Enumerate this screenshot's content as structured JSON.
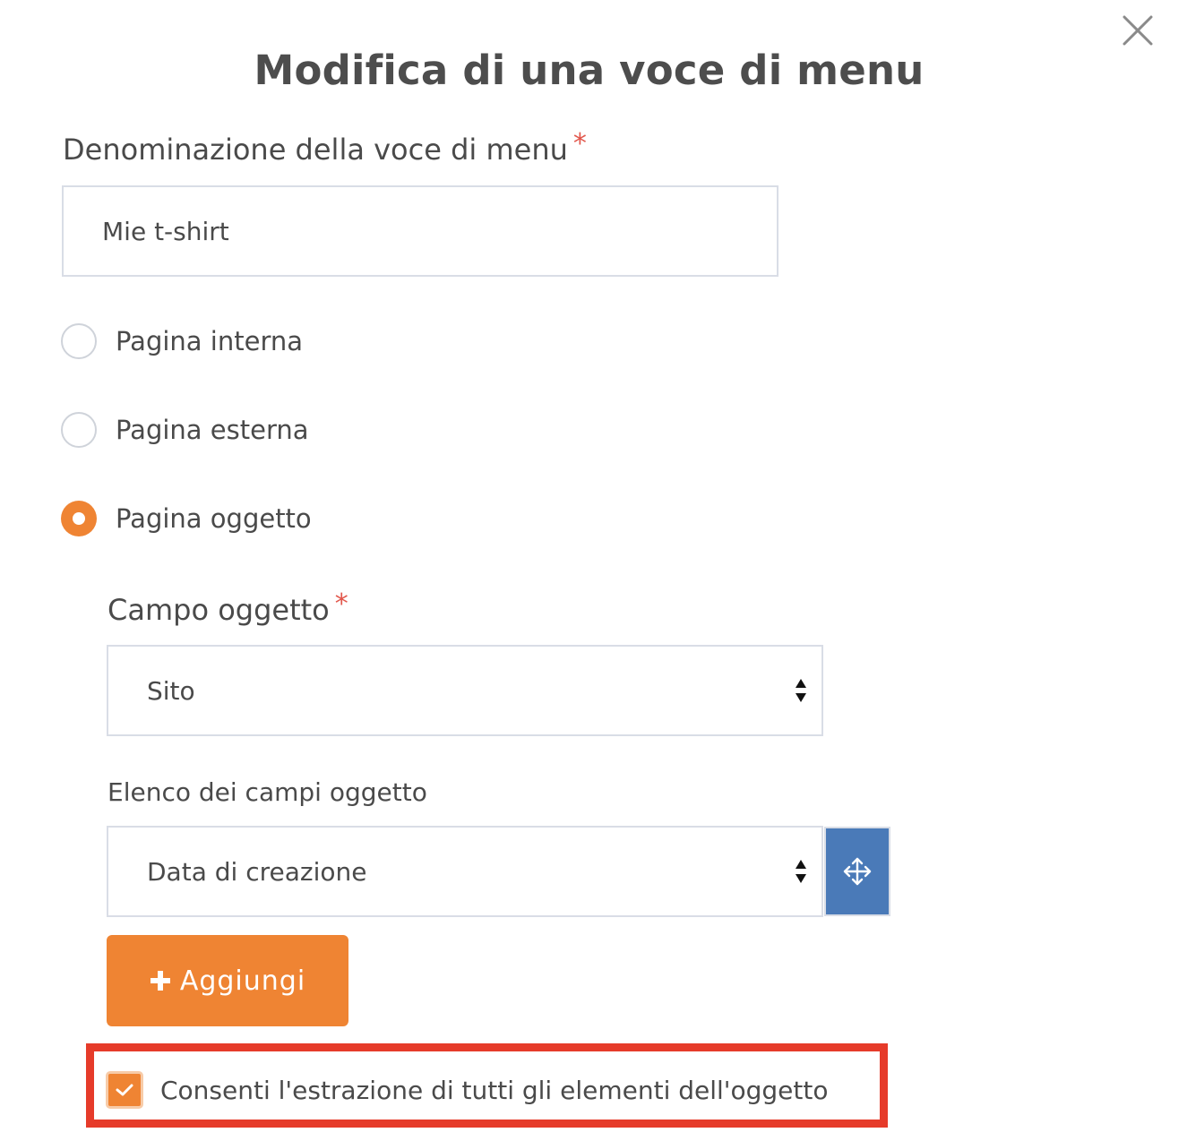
{
  "dialog": {
    "title": "Modifica di una voce di menu",
    "close_icon": "close-icon"
  },
  "name_field": {
    "label": "Denominazione della voce di menu",
    "required_mark": "*",
    "value": "Mie t-shirt"
  },
  "link_type": {
    "options": [
      {
        "label": "Pagina interna",
        "checked": false
      },
      {
        "label": "Pagina esterna",
        "checked": false
      },
      {
        "label": "Pagina oggetto",
        "checked": true
      }
    ]
  },
  "object_field": {
    "label": "Campo oggetto",
    "required_mark": "*",
    "selected": "Sito"
  },
  "object_fields_list": {
    "label": "Elenco dei campi oggetto",
    "selected": "Data di creazione",
    "move_icon": "move-icon"
  },
  "add_button": {
    "label": "Aggiungi",
    "icon": "plus-icon"
  },
  "extract_all": {
    "label": "Consenti l'estrazione di tutti gli elementi dell'oggetto",
    "checked": true
  },
  "colors": {
    "accent": "#ef8433",
    "move_button": "#4a7ab8",
    "required": "#e2574c",
    "highlight_border": "#e63b2a",
    "text": "#4a4a4a"
  }
}
